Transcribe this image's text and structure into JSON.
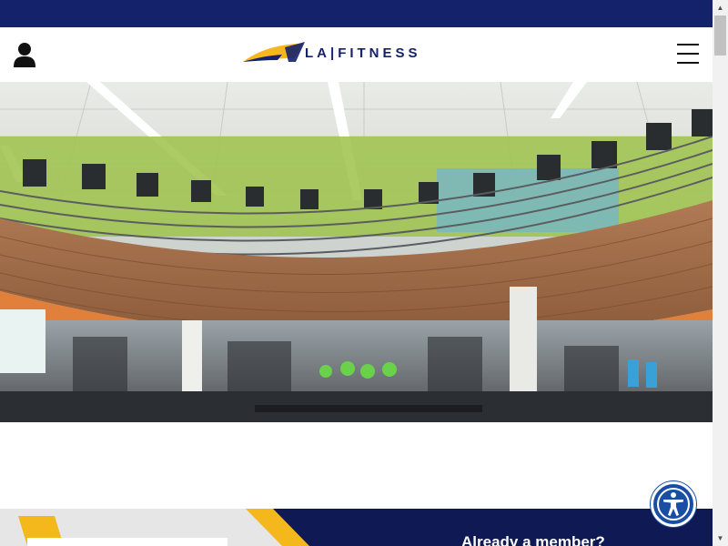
{
  "header": {
    "logo_text": "LA|FITNESS",
    "logo_mark": "LA FITNESS",
    "account_icon": "user-icon",
    "menu_icon": "hamburger-menu-icon"
  },
  "hero": {
    "image": "gym-interior-photo"
  },
  "member_band": {
    "heading": "Already a member?"
  },
  "accessibility": {
    "icon": "accessibility-icon"
  },
  "colors": {
    "brand_navy": "#14216b",
    "brand_gold": "#f5b81c",
    "accessibility_blue": "#1a4ea3"
  }
}
